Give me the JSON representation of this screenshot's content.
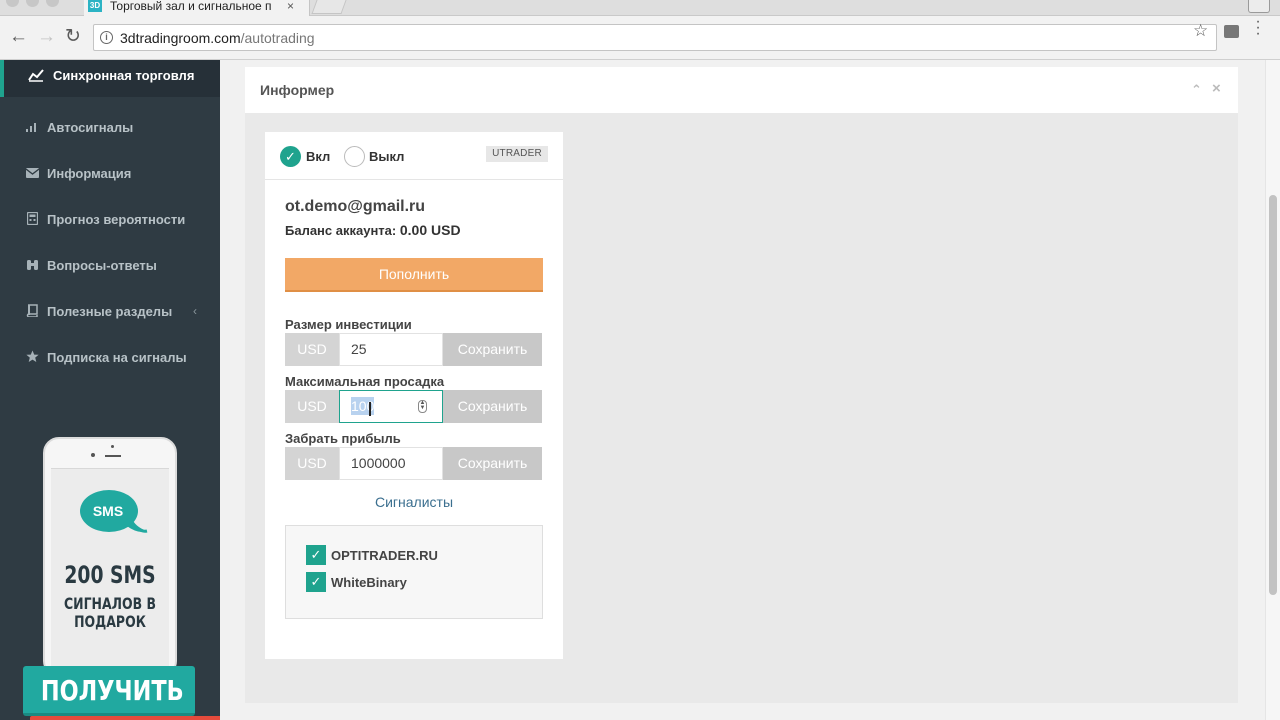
{
  "browser": {
    "tab_title": "Торговый зал и сигнальное п",
    "tab_favicon": "3D",
    "tab_close": "×",
    "url_host": "3dtradingroom.com",
    "url_path": "/autotrading",
    "info_glyph": "i",
    "back_glyph": "←",
    "forward_glyph": "→",
    "reload_glyph": "↻",
    "star_glyph": "☆"
  },
  "sidebar": {
    "active": {
      "label": "Синхронная торговля",
      "icon": "chart-line-icon"
    },
    "items": [
      {
        "label": "Автосигналы",
        "icon": "bar-signal-icon"
      },
      {
        "label": "Информация",
        "icon": "envelope-icon"
      },
      {
        "label": "Прогноз вероятности",
        "icon": "calculator-icon"
      },
      {
        "label": "Вопросы-ответы",
        "icon": "binoculars-icon"
      },
      {
        "label": "Полезные разделы",
        "icon": "book-icon",
        "chevron": "‹"
      },
      {
        "label": "Подписка на сигналы",
        "icon": "star-icon"
      }
    ],
    "promo": {
      "bubble": "SMS",
      "headline": "200 SMS",
      "subline_1": "СИГНАЛОВ В",
      "subline_2": "ПОДАРОК",
      "button": "ПОЛУЧИТЬ"
    }
  },
  "panel": {
    "title": "Информер",
    "collapse_glyph": "⌃",
    "close_glyph": "×"
  },
  "informer": {
    "on_label": "Вкл",
    "off_label": "Выкл",
    "badge": "UTRADER",
    "email": "ot.demo@gmail.ru",
    "balance_label": "Баланс аккаунта:",
    "balance_value": "0.00 USD",
    "topup_button": "Пополнить",
    "fields": [
      {
        "label": "Размер инвестиции",
        "currency": "USD",
        "value": "25",
        "save": "Сохранить"
      },
      {
        "label": "Максимальная просадка",
        "currency": "USD",
        "value": "100",
        "save": "Сохранить"
      },
      {
        "label": "Забрать прибыль",
        "currency": "USD",
        "value": "1000000",
        "save": "Сохранить"
      }
    ],
    "signalers_link": "Сигналисты",
    "signalers": [
      {
        "name": "OPTITRADER.RU",
        "checked": true
      },
      {
        "name": "WhiteBinary",
        "checked": true
      }
    ]
  },
  "colors": {
    "accent": "#1fa38e",
    "topup": "#f2a866",
    "sidebar": "#2f3b43"
  }
}
